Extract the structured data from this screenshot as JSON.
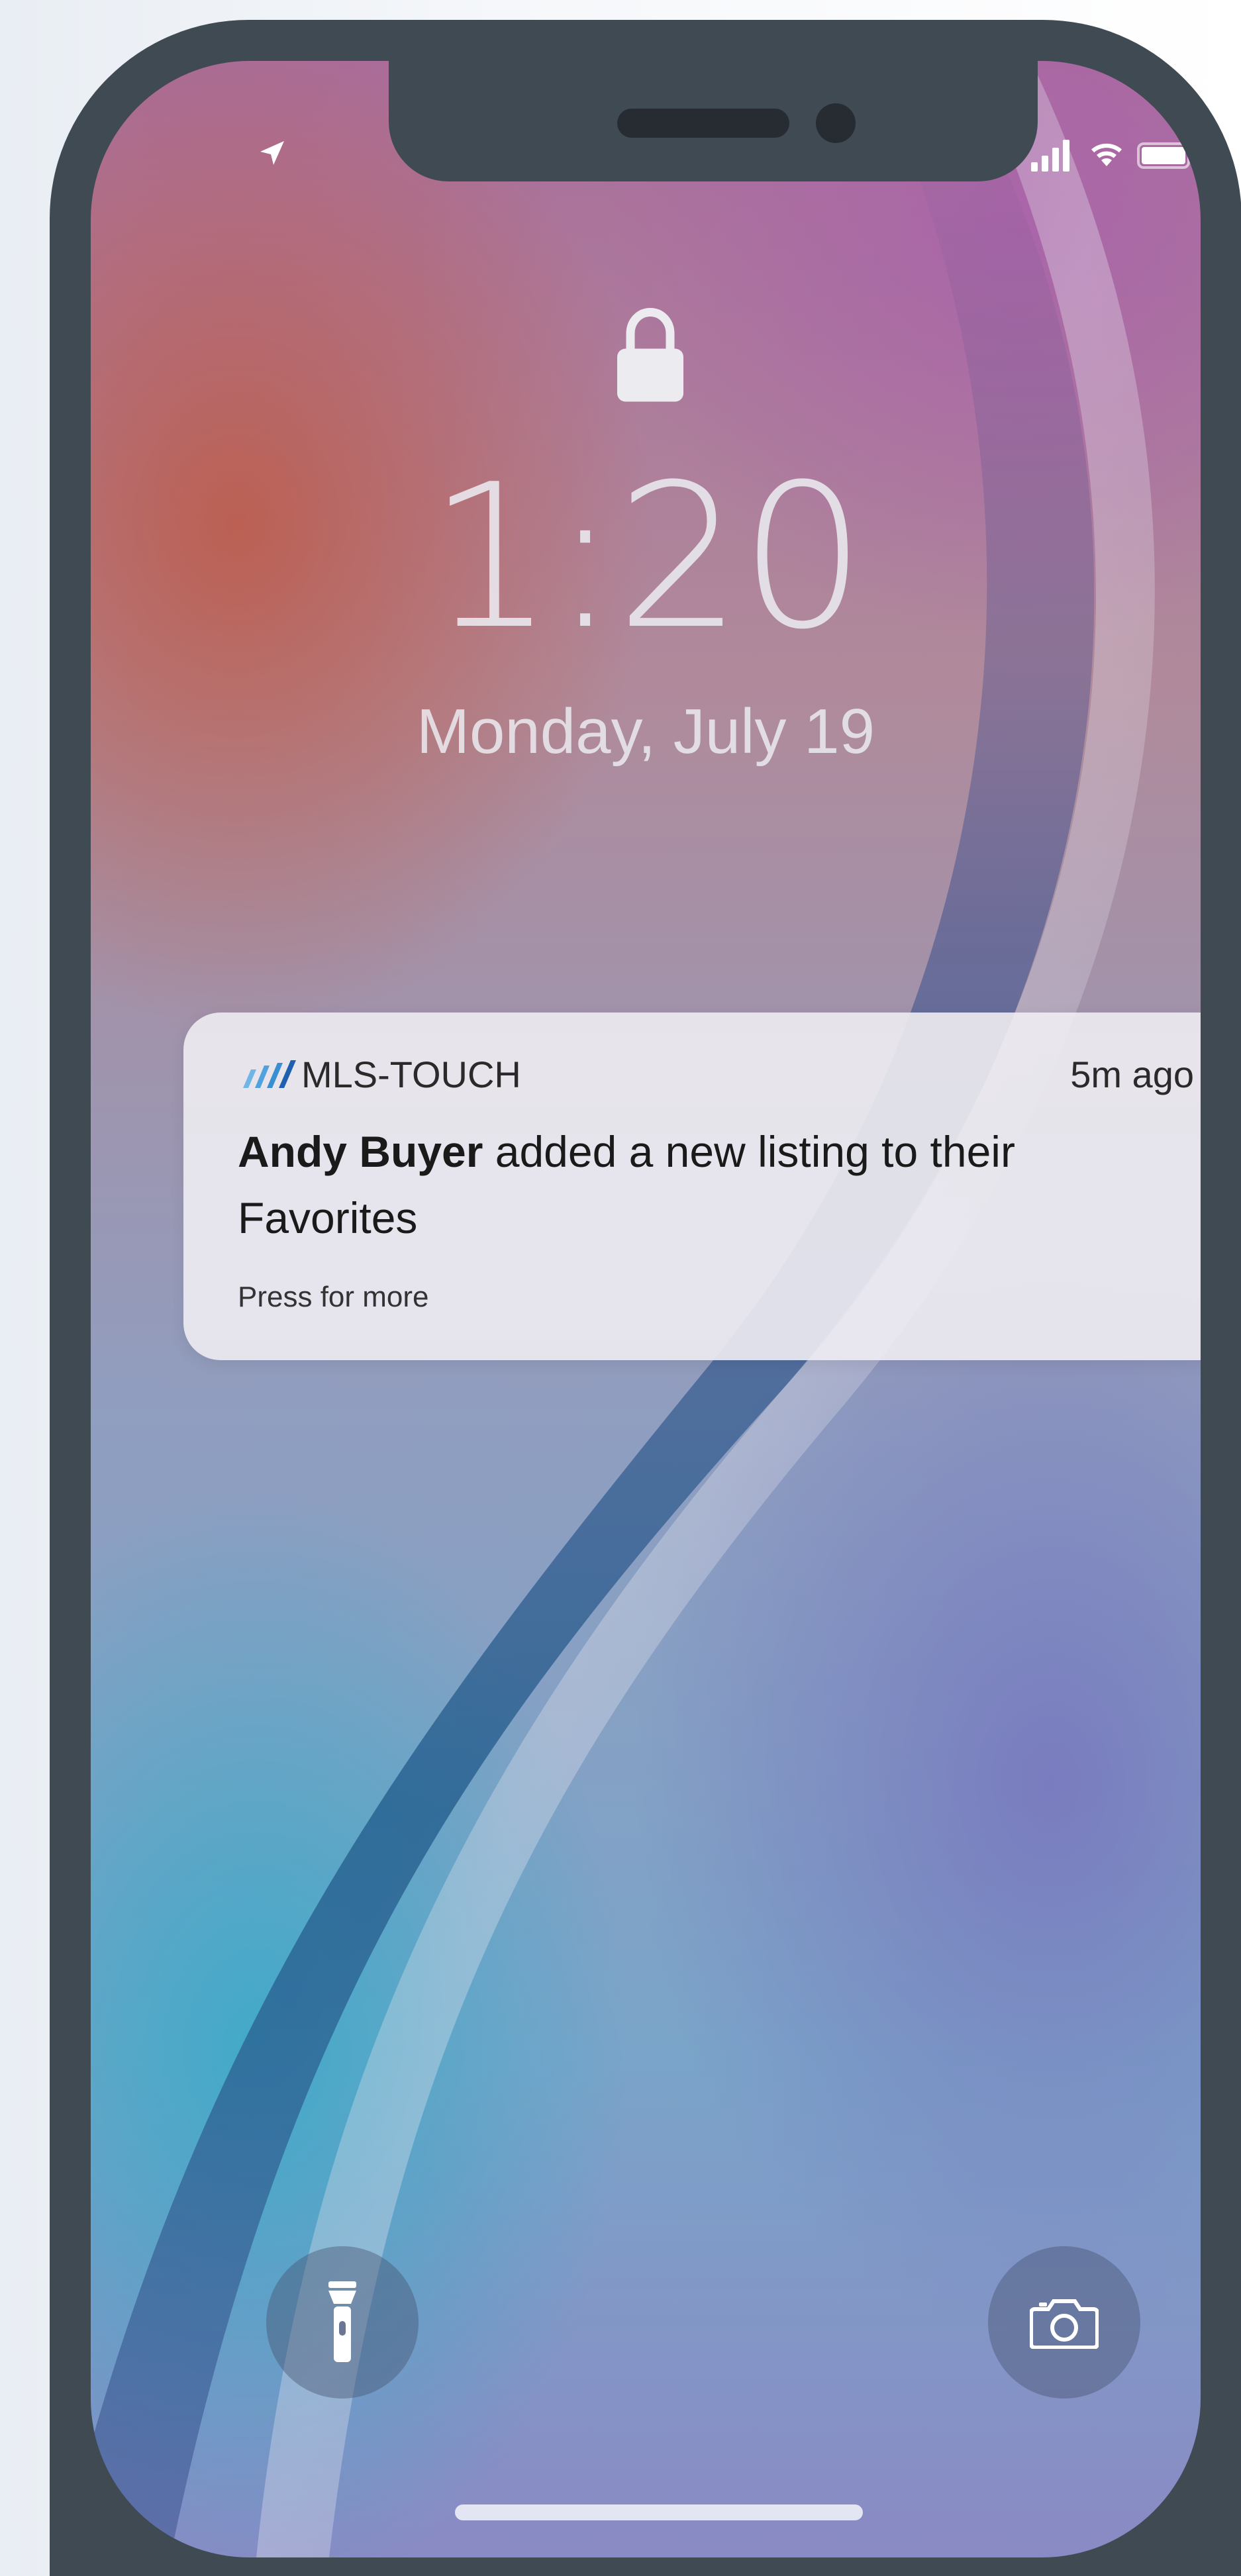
{
  "status_bar": {
    "left_icon": "location-arrow-icon",
    "right_icons": [
      "cellular-signal-icon",
      "wifi-icon",
      "battery-icon"
    ]
  },
  "lock_screen": {
    "lock_icon": "lock-icon",
    "time": "1:20",
    "date": "Monday, July 19"
  },
  "notification": {
    "app_icon": "mls-touch-logo-icon",
    "app_name": "MLS-TOUCH",
    "time_ago": "5m ago",
    "sender": "Andy Buyer",
    "message": " added a new listing to their Favorites",
    "footer": "Press for more",
    "logo_colors": [
      "#6fb6e6",
      "#3a8fd1",
      "#1f5fb0"
    ]
  },
  "bottom_controls": {
    "left_icon": "flashlight-icon",
    "right_icon": "camera-icon"
  },
  "colors": {
    "frame": "#3f4a53",
    "time_text": "#ebebf0",
    "card_bg": "#eeecf2"
  }
}
